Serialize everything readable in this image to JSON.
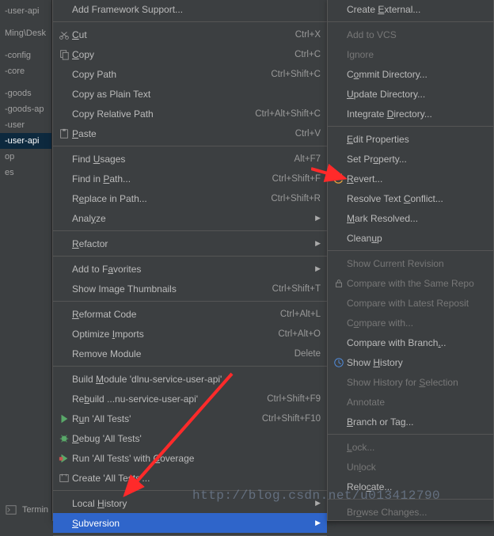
{
  "sidebar": {
    "items": [
      {
        "label": "-user-api"
      },
      {
        "label": ""
      },
      {
        "label": "Ming\\Desk"
      },
      {
        "label": ""
      },
      {
        "label": "-config"
      },
      {
        "label": "-core"
      },
      {
        "label": ""
      },
      {
        "label": "-goods"
      },
      {
        "label": "-goods-ap"
      },
      {
        "label": "-user"
      },
      {
        "label": "-user-api"
      },
      {
        "label": "op"
      },
      {
        "label": "es"
      }
    ],
    "selected_index": 10
  },
  "main_menu": [
    {
      "label": "Add Framework Support...",
      "shortcut": "",
      "icon": "",
      "submenu": false
    },
    {
      "sep": true
    },
    {
      "label": "Cut",
      "u": 0,
      "shortcut": "Ctrl+X",
      "icon": "cut-icon"
    },
    {
      "label": "Copy",
      "u": 0,
      "shortcut": "Ctrl+C",
      "icon": "copy-icon"
    },
    {
      "label": "Copy Path",
      "shortcut": "Ctrl+Shift+C"
    },
    {
      "label": "Copy as Plain Text",
      "shortcut": ""
    },
    {
      "label": "Copy Relative Path",
      "shortcut": "Ctrl+Alt+Shift+C"
    },
    {
      "label": "Paste",
      "u": 0,
      "shortcut": "Ctrl+V",
      "icon": "paste-icon"
    },
    {
      "sep": true
    },
    {
      "label": "Find Usages",
      "u": 5,
      "shortcut": "Alt+F7"
    },
    {
      "label": "Find in Path...",
      "u": 8,
      "shortcut": "Ctrl+Shift+F"
    },
    {
      "label": "Replace in Path...",
      "u": 1,
      "shortcut": "Ctrl+Shift+R"
    },
    {
      "label": "Analyze",
      "u": 4,
      "submenu": true
    },
    {
      "sep": true
    },
    {
      "label": "Refactor",
      "u": 0,
      "submenu": true
    },
    {
      "sep": true
    },
    {
      "label": "Add to Favorites",
      "u": 8,
      "submenu": true
    },
    {
      "label": "Show Image Thumbnails",
      "shortcut": "Ctrl+Shift+T"
    },
    {
      "sep": true
    },
    {
      "label": "Reformat Code",
      "u": 0,
      "shortcut": "Ctrl+Alt+L"
    },
    {
      "label": "Optimize Imports",
      "u": 9,
      "shortcut": "Ctrl+Alt+O"
    },
    {
      "label": "Remove Module",
      "shortcut": "Delete"
    },
    {
      "sep": true
    },
    {
      "label": "Build Module 'dlnu-service-user-api'",
      "u": 6
    },
    {
      "label": "Rebuild ...nu-service-user-api'",
      "u": 2,
      "shortcut": "Ctrl+Shift+F9"
    },
    {
      "label": "Run 'All Tests'",
      "u": 1,
      "shortcut": "Ctrl+Shift+F10",
      "icon": "run-icon"
    },
    {
      "label": "Debug 'All Tests'",
      "u": 0,
      "icon": "debug-icon"
    },
    {
      "label": "Run 'All Tests' with Coverage",
      "u": 21,
      "icon": "coverage-icon"
    },
    {
      "label": "Create 'All Tests'...",
      "icon": "create-icon"
    },
    {
      "sep": true
    },
    {
      "label": "Local History",
      "u": 6,
      "submenu": true
    },
    {
      "label": "Subversion",
      "u": 0,
      "submenu": true,
      "selected": true
    },
    {
      "sep": true
    }
  ],
  "sub_menu": [
    {
      "label": "Create External...",
      "u": 7
    },
    {
      "sep": true
    },
    {
      "label": "Add to VCS",
      "disabled": true
    },
    {
      "label": "Ignore",
      "disabled": true
    },
    {
      "label": "Commit Directory...",
      "u": 1
    },
    {
      "label": "Update Directory...",
      "u": 0
    },
    {
      "label": "Integrate Directory...",
      "u": 10
    },
    {
      "sep": true
    },
    {
      "label": "Edit Properties",
      "u": 0
    },
    {
      "label": "Set Property...",
      "u": 6
    },
    {
      "label": "Revert...",
      "u": 0,
      "icon": "revert-icon"
    },
    {
      "label": "Resolve Text Conflict...",
      "u": 13
    },
    {
      "label": "Mark Resolved...",
      "u": 0
    },
    {
      "label": "Cleanup",
      "u": 5
    },
    {
      "sep": true
    },
    {
      "label": "Show Current Revision",
      "disabled": true
    },
    {
      "label": "Compare with the Same Repo",
      "icon": "lock-small-icon",
      "disabled": true
    },
    {
      "label": "Compare with Latest Reposit",
      "disabled": true
    },
    {
      "label": "Compare with...",
      "u": 1,
      "disabled": true
    },
    {
      "label": "Compare with Branch...",
      "u": 19
    },
    {
      "label": "Show History",
      "u": 5,
      "icon": "history-icon"
    },
    {
      "label": "Show History for Selection",
      "u": 17,
      "disabled": true
    },
    {
      "label": "Annotate",
      "disabled": true
    },
    {
      "label": "Branch or Tag...",
      "u": 0
    },
    {
      "sep": true
    },
    {
      "label": "Lock...",
      "u": 0,
      "disabled": true
    },
    {
      "label": "Unlock",
      "u": 2,
      "disabled": true
    },
    {
      "label": "Relocate...",
      "u": 4
    },
    {
      "sep": true
    },
    {
      "label": "Browse Changes...",
      "u": 2,
      "disabled": true
    }
  ],
  "terminal_label": "Termin",
  "watermark": "http://blog.csdn.net/u013412790"
}
